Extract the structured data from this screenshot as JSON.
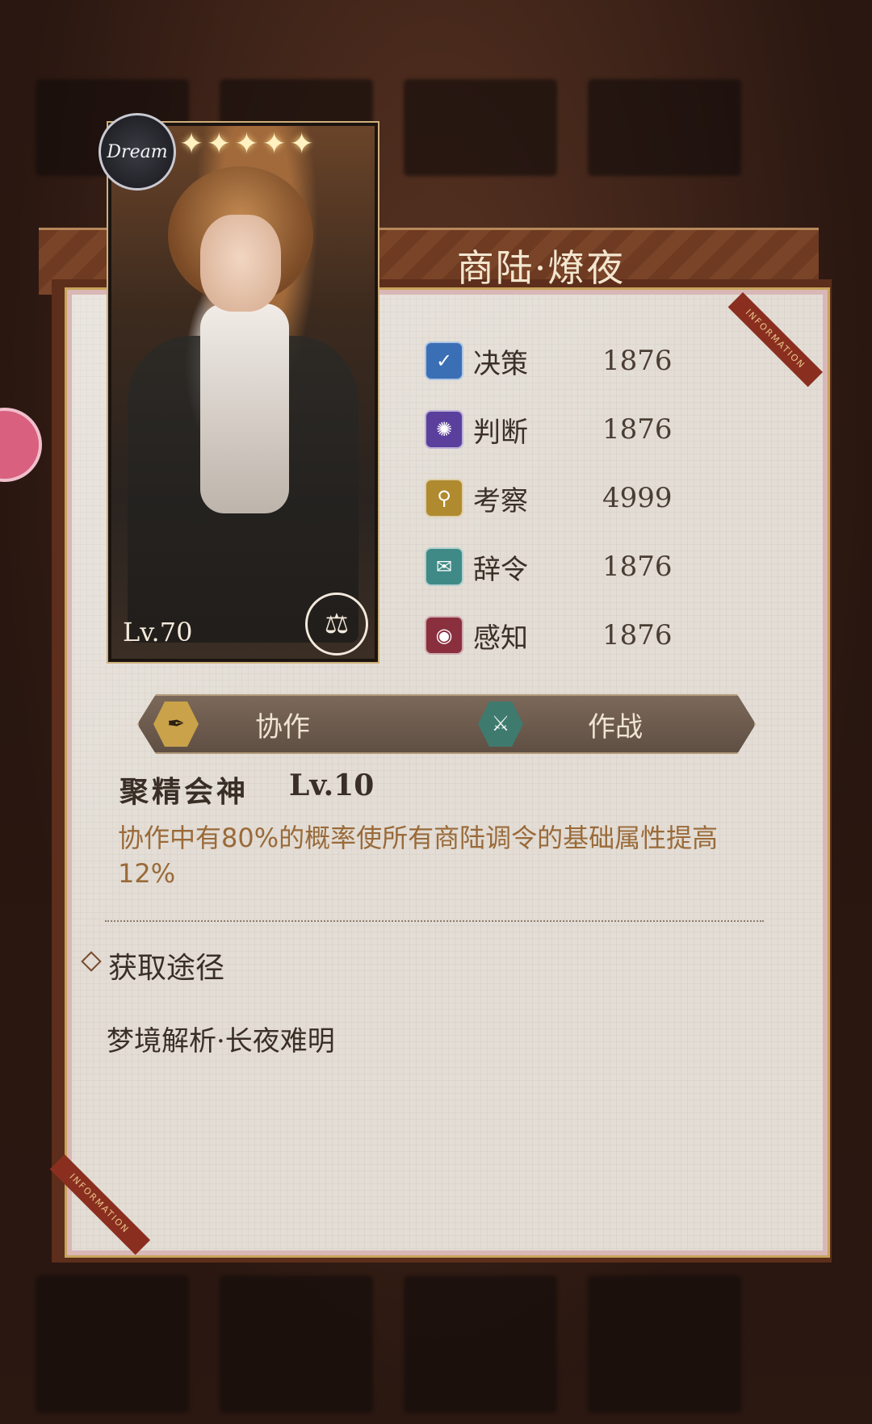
{
  "card": {
    "title": "商陆·燎夜",
    "level_label": "Lv.70",
    "badge_text": "Dream",
    "stars": "✦✦✦✦✦",
    "corner_label": "INFORMATION"
  },
  "stats": [
    {
      "label": "决策",
      "value": "1876",
      "color": "#3a6fb5",
      "icon": "decision-icon"
    },
    {
      "label": "判断",
      "value": "1876",
      "color": "#5a3f9c",
      "icon": "judgment-icon"
    },
    {
      "label": "考察",
      "value": "4999",
      "color": "#b08a2e",
      "icon": "inspect-icon"
    },
    {
      "label": "辞令",
      "value": "1876",
      "color": "#3f8a86",
      "icon": "rhetoric-icon"
    },
    {
      "label": "感知",
      "value": "1876",
      "color": "#8a2f3d",
      "icon": "perception-icon"
    }
  ],
  "tabs": {
    "cooperate": "协作",
    "battle": "作战"
  },
  "skill": {
    "name": "聚精会神",
    "level": "Lv.10",
    "description": "协作中有80%的概率使所有商陆调令的基础属性提高12%"
  },
  "acquire": {
    "title": "获取途径",
    "source": "梦境解析·长夜难明"
  }
}
